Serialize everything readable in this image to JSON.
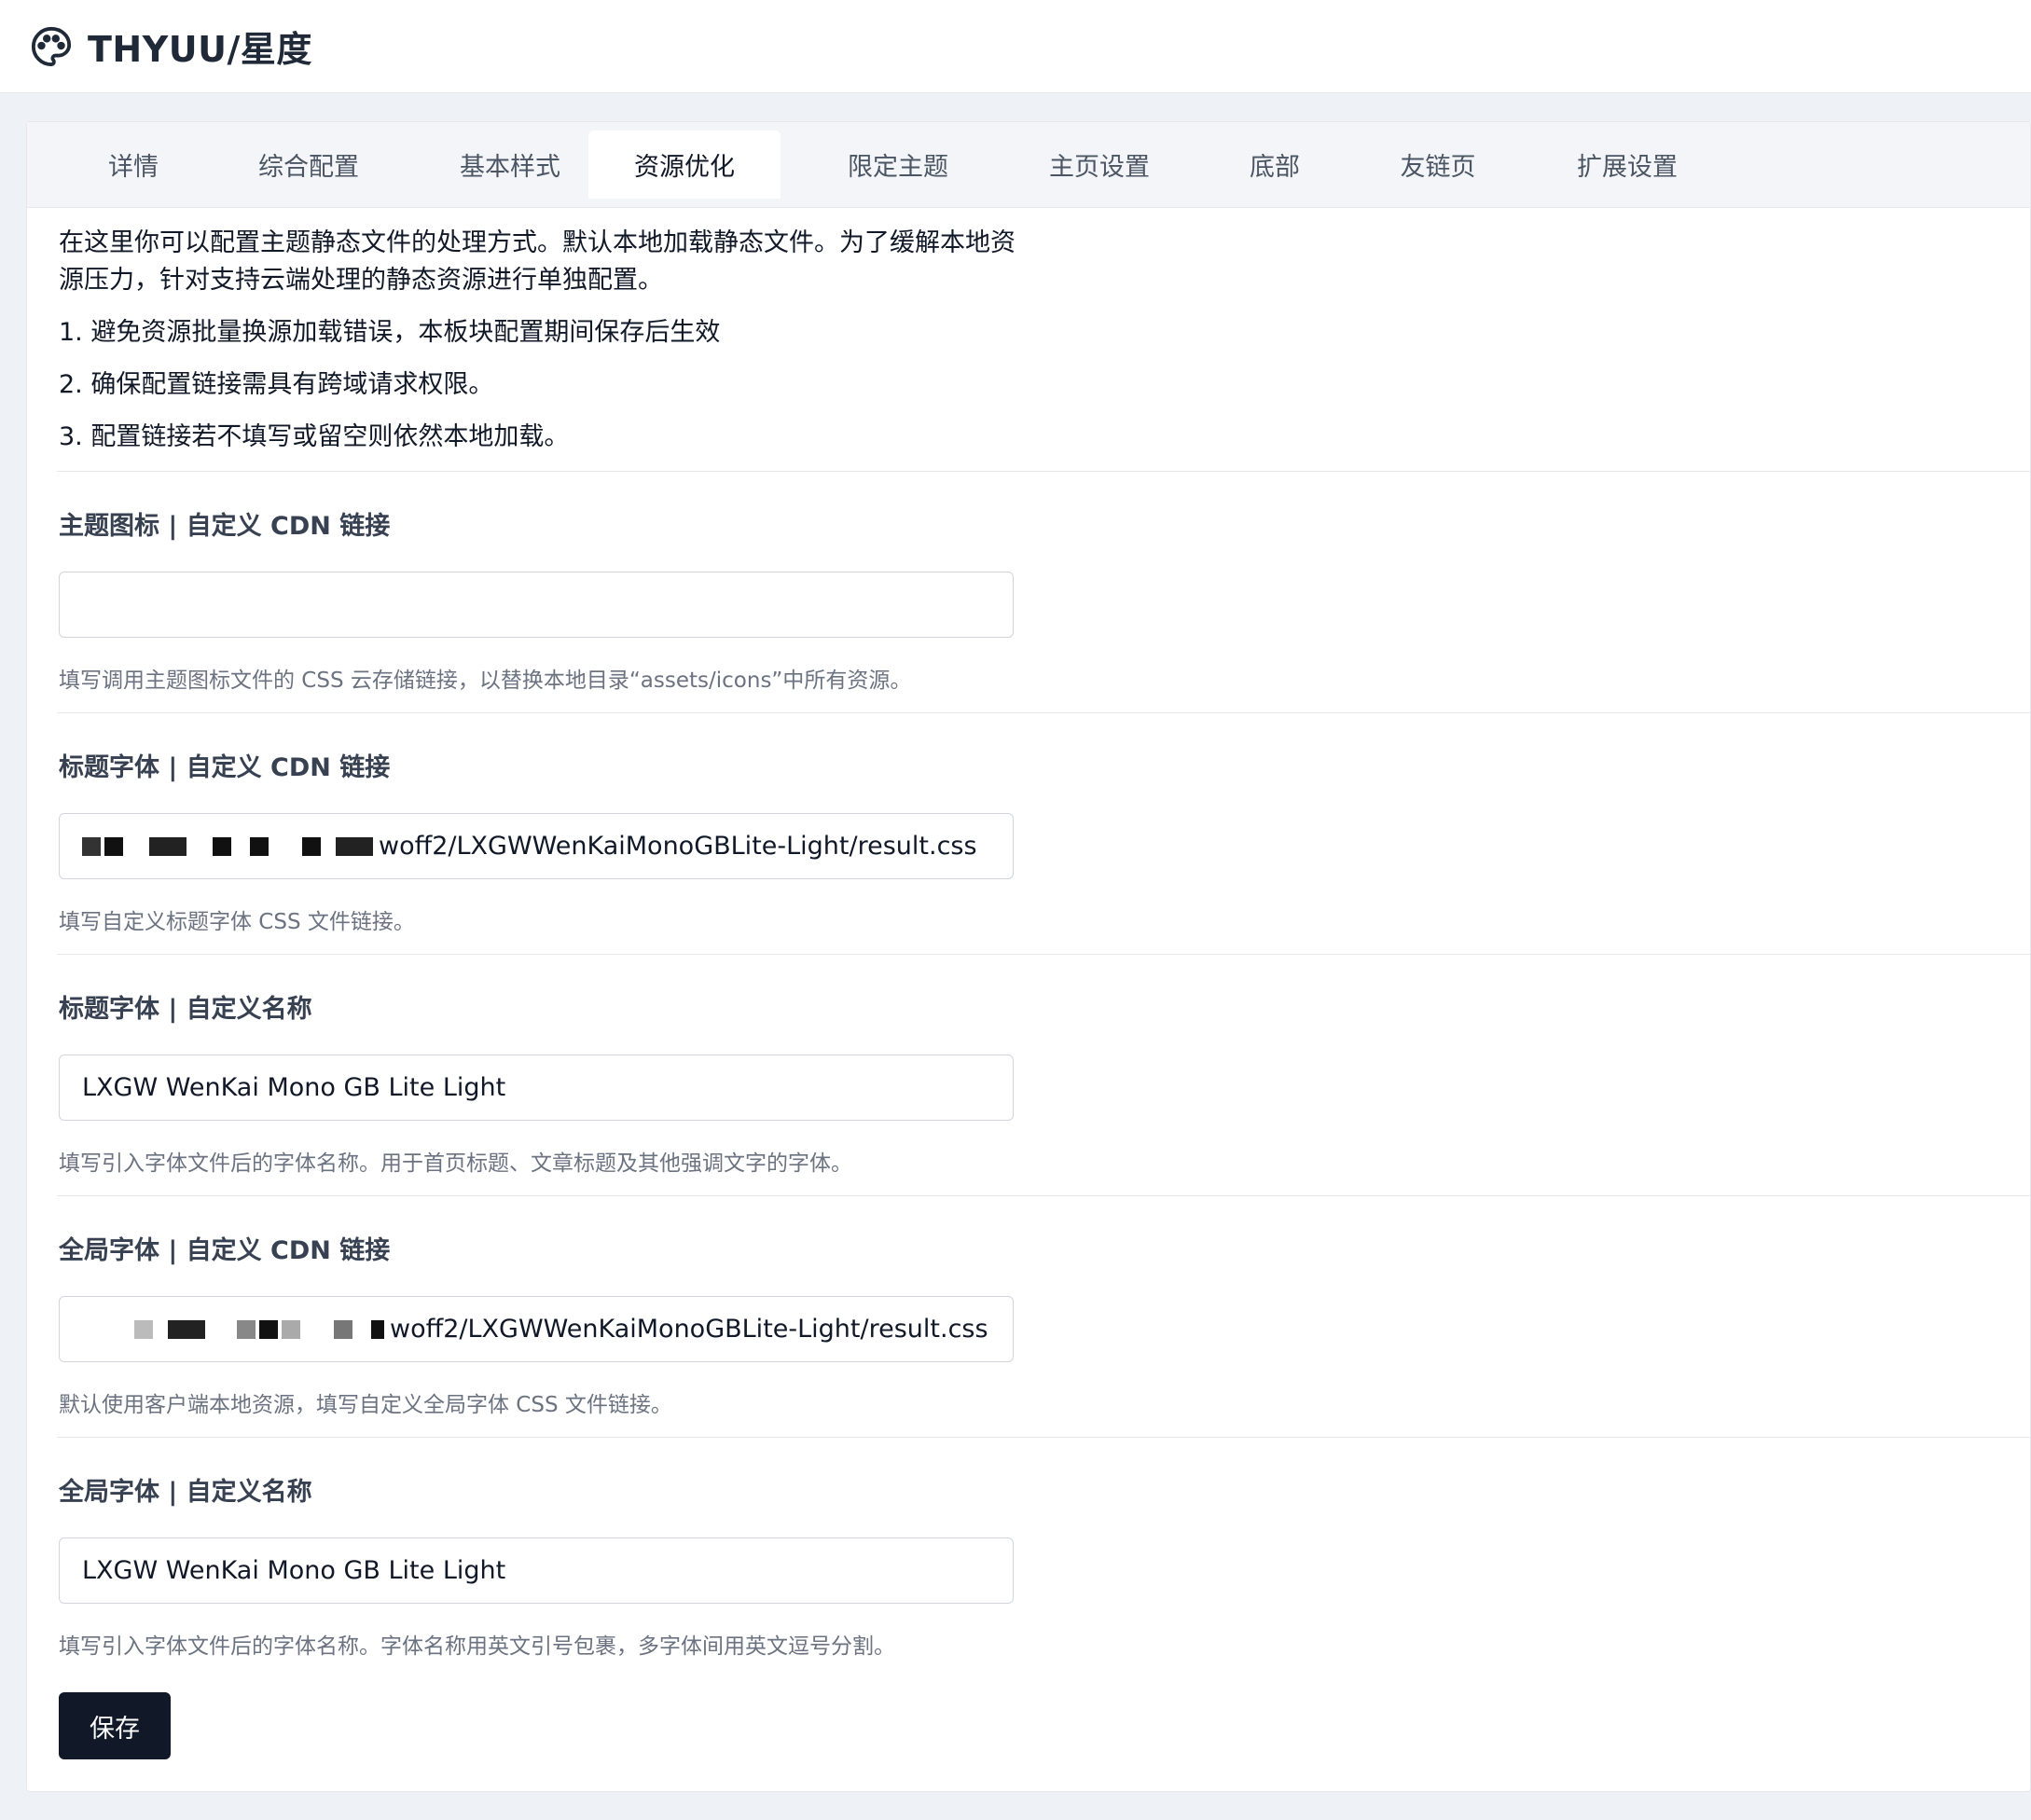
{
  "header": {
    "title": "THYUU/星度",
    "icon": "palette-icon"
  },
  "tabs": [
    {
      "label": "详情",
      "active": false
    },
    {
      "label": "综合配置",
      "active": false
    },
    {
      "label": "基本样式",
      "active": false
    },
    {
      "label": "资源优化",
      "active": true
    },
    {
      "label": "限定主题",
      "active": false
    },
    {
      "label": "主页设置",
      "active": false
    },
    {
      "label": "底部",
      "active": false
    },
    {
      "label": "友链页",
      "active": false
    },
    {
      "label": "扩展设置",
      "active": false
    }
  ],
  "intro": {
    "text": "在这里你可以配置主题静态文件的处理方式。默认本地加载静态文件。为了缓解本地资源压力，针对支持云端处理的静态资源进行单独配置。",
    "items": [
      "1. 避免资源批量换源加载错误，本板块配置期间保存后生效",
      "2. 确保配置链接需具有跨域请求权限。",
      "3. 配置链接若不填写或留空则依然本地加载。"
    ]
  },
  "fields": [
    {
      "label": "主题图标 | 自定义 CDN 链接",
      "value": "",
      "help": "填写调用主题图标文件的 CSS 云存储链接，以替换本地目录“assets/icons”中所有资源。"
    },
    {
      "label": "标题字体 | 自定义 CDN 链接",
      "value": "woff2/LXGWWenKaiMonoGBLite-Light/result.css",
      "help": "填写自定义标题字体 CSS 文件链接。"
    },
    {
      "label": "标题字体 | 自定义名称",
      "value": "LXGW WenKai Mono GB Lite Light",
      "help": "填写引入字体文件后的字体名称。用于首页标题、文章标题及其他强调文字的字体。"
    },
    {
      "label": "全局字体 | 自定义 CDN 链接",
      "value": "woff2/LXGWWenKaiMonoGBLite-Light/result.css",
      "help": "默认使用客户端本地资源，填写自定义全局字体 CSS 文件链接。"
    },
    {
      "label": "全局字体 | 自定义名称",
      "value": "LXGW WenKai Mono GB Lite Light",
      "help": "填写引入字体文件后的字体名称。字体名称用英文引号包裹，多字体间用英文逗号分割。"
    }
  ],
  "save_label": "保存",
  "colors": {
    "accent": "#111827",
    "tab_bar": "#f3f5f8",
    "page_bg": "#eef2f6"
  }
}
